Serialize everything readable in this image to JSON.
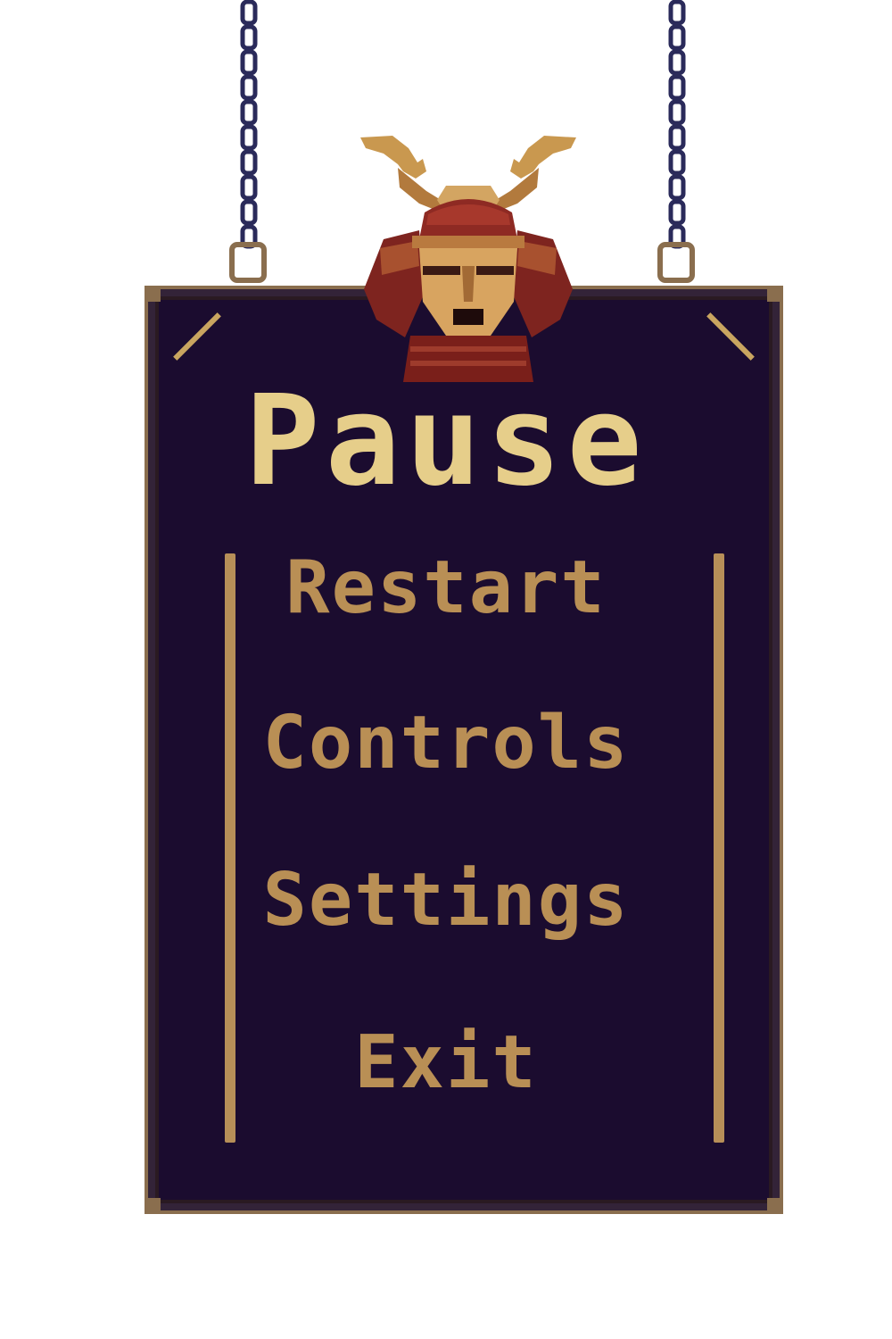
{
  "pause_menu": {
    "title": "Pause",
    "items": [
      {
        "id": "restart",
        "label": "Restart"
      },
      {
        "id": "controls",
        "label": "Controls"
      },
      {
        "id": "settings",
        "label": "Settings"
      },
      {
        "id": "exit",
        "label": "Exit"
      }
    ]
  },
  "colors": {
    "panel_background": "#1b0c2f",
    "frame": "#8a6e4e",
    "title_text": "#e6ce8a",
    "menu_text": "#b98f55",
    "chain": "#2a2a5a"
  },
  "icons": [
    "chain-icon",
    "samurai-helmet-icon"
  ]
}
